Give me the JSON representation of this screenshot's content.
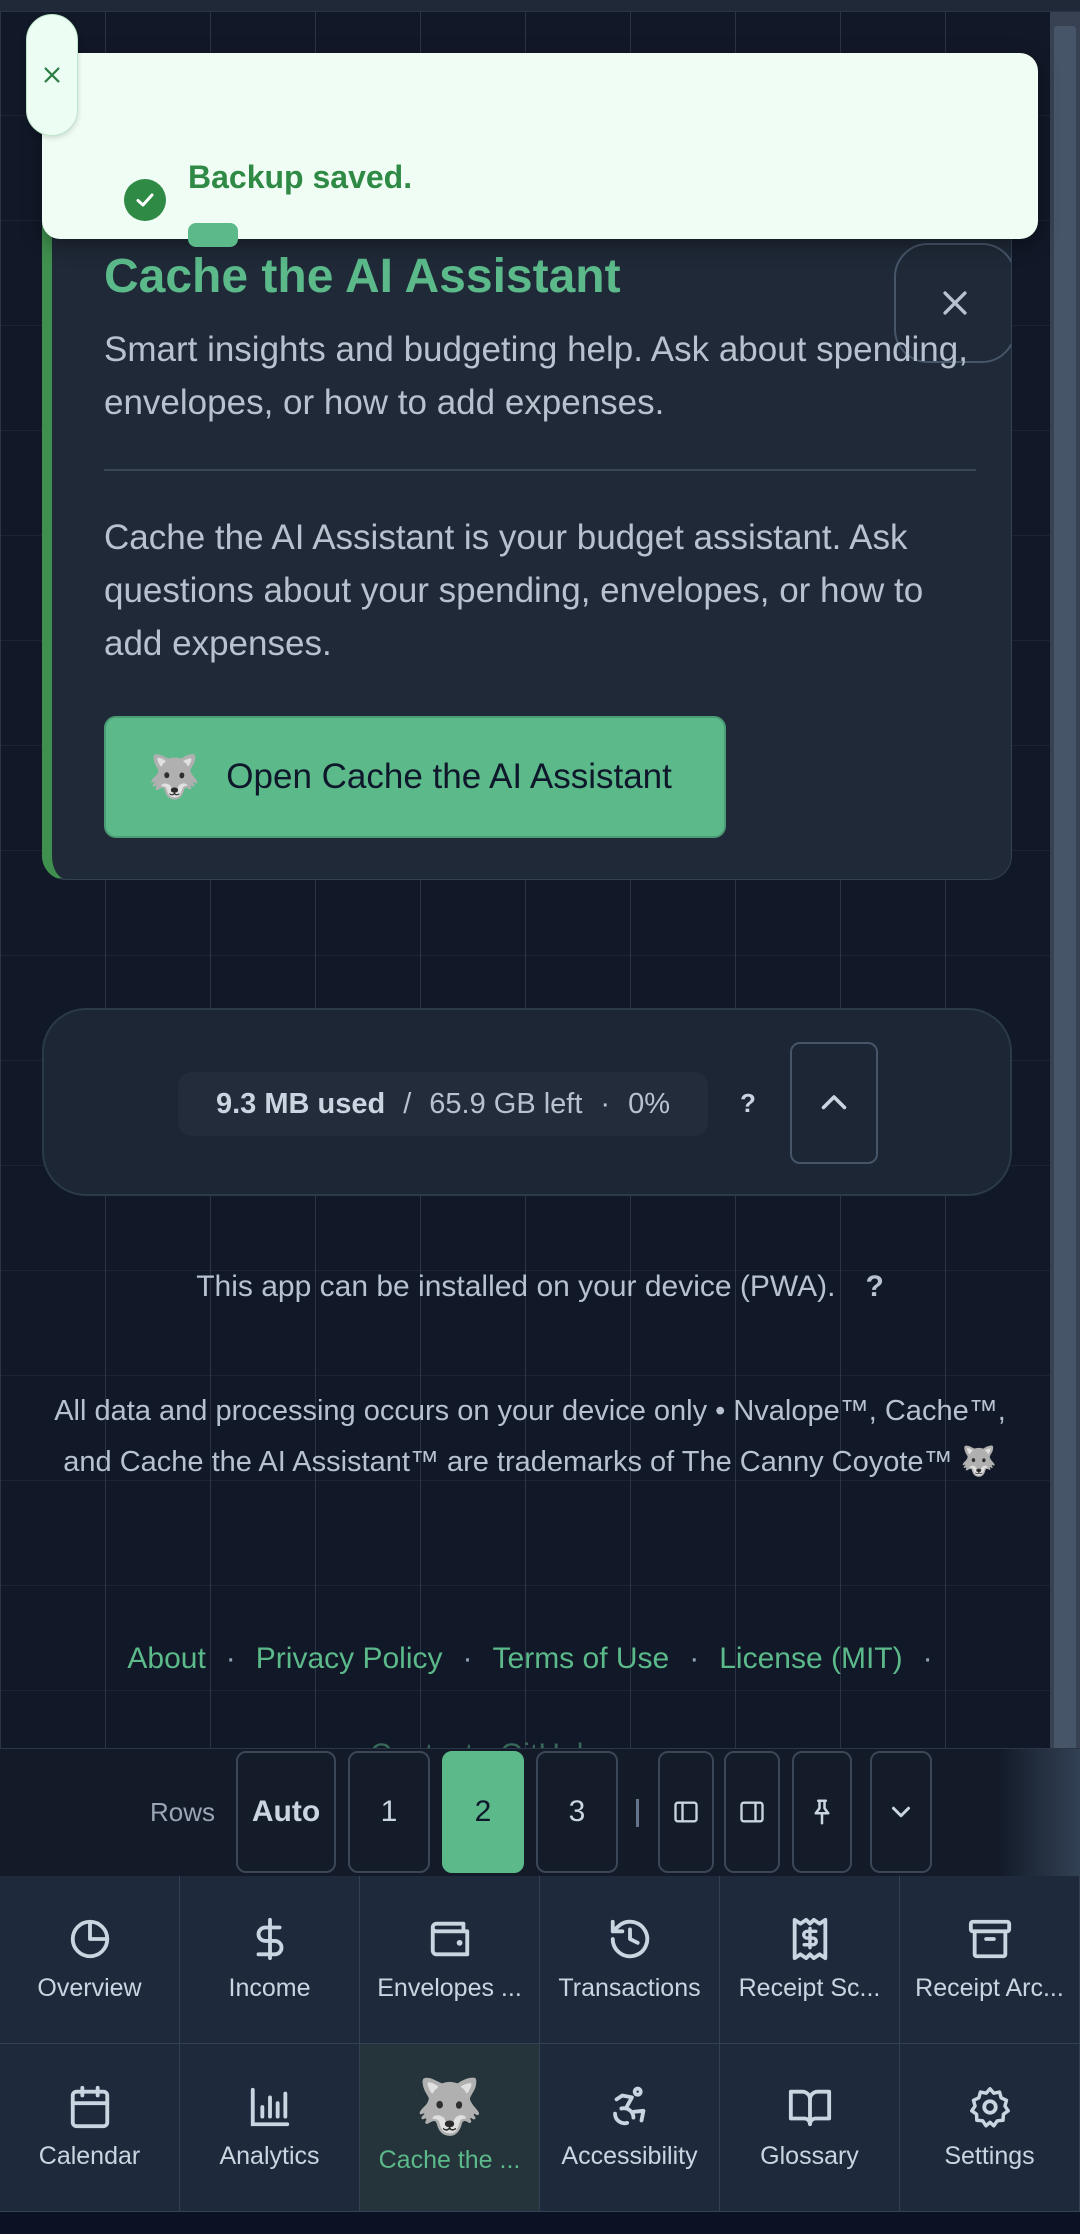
{
  "toast": {
    "message": "Backup saved."
  },
  "assistant": {
    "title": "Cache the AI Assistant",
    "subtitle": "Smart insights and budgeting help. Ask about spending, envelopes, or how to add expenses.",
    "body": "Cache the AI Assistant is your budget assistant. Ask questions about your spending, envelopes, or how to add expenses.",
    "button_emoji": "🐺",
    "button_label": "Open Cache the AI Assistant"
  },
  "storage": {
    "used": "9.3 MB used",
    "slash": "/",
    "left": "65.9 GB left",
    "dot": "·",
    "percent": "0%",
    "help": "?"
  },
  "pwa": {
    "text": "This app can be installed on your device (PWA).",
    "help": "?"
  },
  "legal": {
    "text": "All data and processing occurs on your device only • Nvalope™, Cache™, and Cache the AI Assistant™ are trademarks of The Canny Coyote™ 🐺"
  },
  "footer_links": [
    "About",
    "Privacy Policy",
    "Terms of Use",
    "License (MIT)"
  ],
  "footer_link_sep": "·",
  "footer_more": "Contact    ·    GitHub",
  "rows_bar": {
    "label": "Rows",
    "options": [
      "Auto",
      "1",
      "2",
      "3"
    ],
    "selected": "2"
  },
  "nav": [
    {
      "label": "Overview",
      "icon": "pie-chart-icon"
    },
    {
      "label": "Income",
      "icon": "dollar-icon"
    },
    {
      "label": "Envelopes ...",
      "icon": "wallet-icon"
    },
    {
      "label": "Transactions",
      "icon": "history-icon"
    },
    {
      "label": "Receipt Sc...",
      "icon": "receipt-icon"
    },
    {
      "label": "Receipt Arc...",
      "icon": "archive-icon"
    },
    {
      "label": "Calendar",
      "icon": "calendar-icon"
    },
    {
      "label": "Analytics",
      "icon": "bar-chart-icon"
    },
    {
      "label": "Cache the ...",
      "icon": "wolf-icon",
      "active": true
    },
    {
      "label": "Accessibility",
      "icon": "accessibility-icon"
    },
    {
      "label": "Glossary",
      "icon": "book-icon"
    },
    {
      "label": "Settings",
      "icon": "gear-icon"
    }
  ],
  "colors": {
    "accent": "#5bb98a",
    "background": "#111827",
    "card": "#1f2937",
    "toast_bg": "#f0fdf4",
    "toast_text": "#2f8a45"
  }
}
